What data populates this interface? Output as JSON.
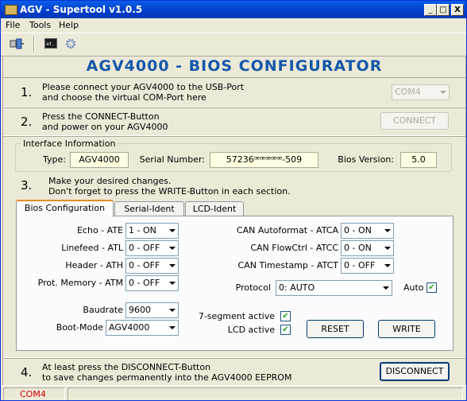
{
  "window": {
    "title": "AGV - Supertool v1.0.5"
  },
  "controls": {
    "minimize": "_",
    "maximize": "□",
    "close": "X"
  },
  "menu": [
    "File",
    "Tools",
    "Help"
  ],
  "header": "AGV4000 - BIOS CONFIGURATOR",
  "step1": {
    "num": "1.",
    "line1": "Please connect your AGV4000 to the USB-Port",
    "line2": "and choose the virtual COM-Port here",
    "port": "COM4"
  },
  "step2": {
    "num": "2.",
    "line1": "Press the CONNECT-Button",
    "line2": "and power on your AGV4000",
    "button": "CONNECT"
  },
  "interface": {
    "title": "Interface Information",
    "type_label": "Type:",
    "type_value": "AGV4000",
    "serial_label": "Serial Number:",
    "serial_value": "57236ꟹꟹꟹꟹꟹ-509",
    "bios_label": "Bios Version:",
    "bios_value": "5.0"
  },
  "step3": {
    "num": "3.",
    "line1": "Make your desired changes.",
    "line2": "Don't forget to press the WRITE-Button in each section."
  },
  "tabs": [
    "Bios Configuration",
    "Serial-Ident",
    "LCD-Ident"
  ],
  "left_fields": [
    {
      "label": "Echo - ATE",
      "value": "1 - ON"
    },
    {
      "label": "Linefeed - ATL",
      "value": "0 - OFF"
    },
    {
      "label": "Header - ATH",
      "value": "0 - OFF"
    },
    {
      "label": "Prot. Memory - ATM",
      "value": "0 - OFF"
    }
  ],
  "right_fields": [
    {
      "label": "CAN Autoformat - ATCA",
      "value": "0 - ON"
    },
    {
      "label": "CAN FlowCtrl - ATCC",
      "value": "0 - ON"
    },
    {
      "label": "CAN Timestamp - ATCT",
      "value": "0 - OFF"
    }
  ],
  "protocol": {
    "label": "Protocol",
    "value": "0: AUTO",
    "auto_label": "Auto",
    "auto_checked": true
  },
  "baudrate": {
    "label": "Baudrate",
    "value": "9600"
  },
  "bootmode": {
    "label": "Boot-Mode",
    "value": "AGV4000"
  },
  "seg7": {
    "label": "7-segment active",
    "checked": true
  },
  "lcd": {
    "label": "LCD active",
    "checked": true
  },
  "buttons": {
    "reset": "RESET",
    "write": "WRITE",
    "disconnect": "DISCONNECT"
  },
  "step4": {
    "num": "4.",
    "line1": "At least press the DISCONNECT-Button",
    "line2": "to save changes permanently into the AGV4000 EEPROM"
  },
  "status": {
    "port": "COM4"
  },
  "icons": {
    "connect": "plug-icon",
    "terminal": "terminal-icon",
    "settings": "gear-icon"
  },
  "colors": {
    "header": "#1558a8",
    "status_port": "#cc0000",
    "titlebar": "#0347d3"
  }
}
